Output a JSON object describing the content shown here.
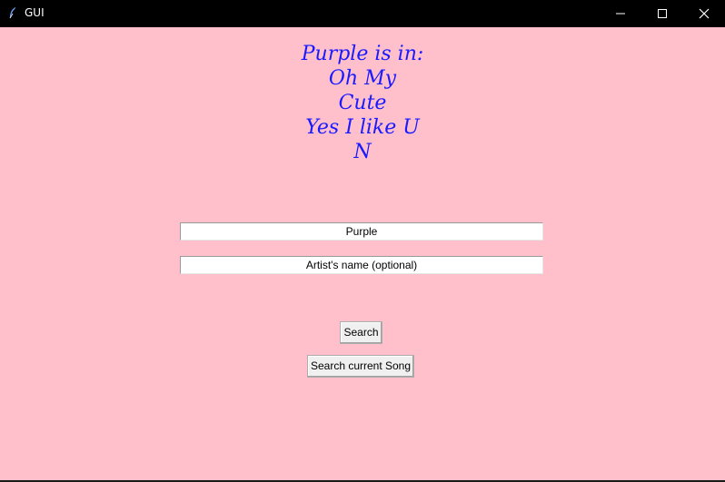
{
  "window": {
    "title": "GUI",
    "icons": {
      "app": "feather-icon",
      "minimize": "minimize-icon",
      "maximize": "maximize-icon",
      "close": "close-icon"
    }
  },
  "headline": {
    "lines": [
      "Purple is in:",
      "Oh My",
      "Cute",
      "Yes I like U",
      "N"
    ],
    "color": "#1a1aff"
  },
  "form": {
    "song_value": "Purple",
    "artist_value": "Artist's name (optional)"
  },
  "buttons": {
    "search": "Search",
    "search_current": "Search current Song"
  },
  "colors": {
    "background": "#ffc0cb",
    "titlebar": "#000000"
  }
}
